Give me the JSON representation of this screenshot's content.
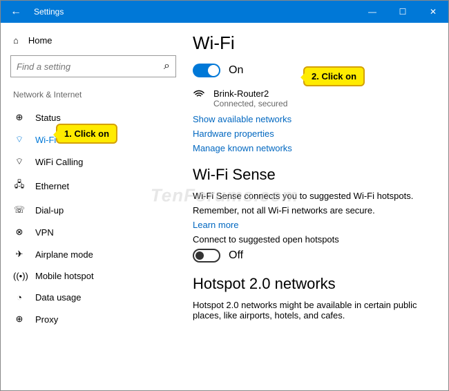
{
  "titlebar": {
    "title": "Settings",
    "back": "←",
    "min": "—",
    "max": "☐",
    "close": "✕"
  },
  "sidebar": {
    "home": "Home",
    "search_placeholder": "Find a setting",
    "section": "Network & Internet",
    "items": [
      {
        "icon": "⊕",
        "label": "Status"
      },
      {
        "icon": "⌔",
        "label": "Wi-Fi"
      },
      {
        "icon": "⌔",
        "label": "WiFi Calling"
      },
      {
        "icon": "🖧",
        "label": "Ethernet"
      },
      {
        "icon": "☏",
        "label": "Dial-up"
      },
      {
        "icon": "⊗",
        "label": "VPN"
      },
      {
        "icon": "✈",
        "label": "Airplane mode"
      },
      {
        "icon": "((•))",
        "label": "Mobile hotspot"
      },
      {
        "icon": "◔",
        "label": "Data usage"
      },
      {
        "icon": "⊕",
        "label": "Proxy"
      }
    ]
  },
  "main": {
    "heading": "Wi-Fi",
    "toggle_state": "On",
    "network": {
      "name": "Brink-Router2",
      "status": "Connected, secured"
    },
    "links": {
      "show": "Show available networks",
      "hw": "Hardware properties",
      "manage": "Manage known networks",
      "learn": "Learn more"
    },
    "sense_heading": "Wi-Fi Sense",
    "sense_body1": "Wi-Fi Sense connects you to suggested Wi-Fi hotspots.",
    "sense_body2": "Remember, not all Wi-Fi networks are secure.",
    "sense_toggle_label": "Connect to suggested open hotspots",
    "sense_toggle_state": "Off",
    "hotspot_heading": "Hotspot 2.0 networks",
    "hotspot_body": "Hotspot 2.0 networks might be available in certain public places, like airports, hotels, and cafes."
  },
  "callouts": {
    "c1": "1. Click on",
    "c2": "2. Click on"
  },
  "watermark": "TenForums.com"
}
